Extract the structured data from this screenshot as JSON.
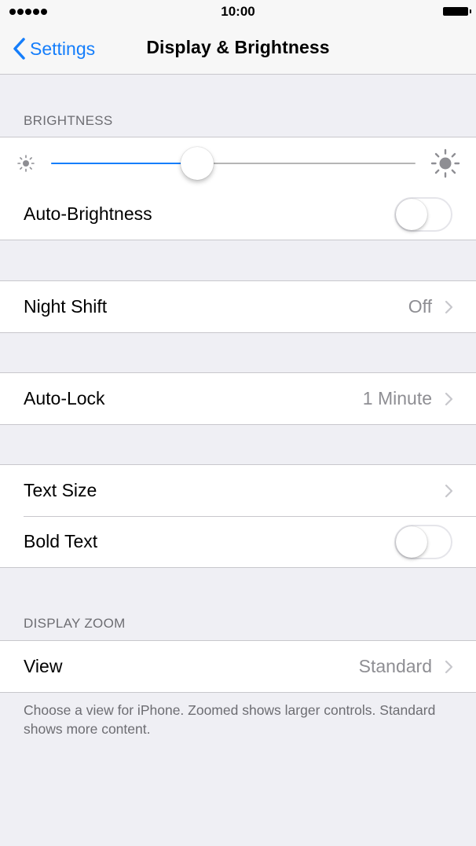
{
  "status_bar": {
    "time": "10:00",
    "signal_dots": 5
  },
  "nav": {
    "back_label": "Settings",
    "title": "Display & Brightness"
  },
  "brightness": {
    "header": "BRIGHTNESS",
    "level": 0.4,
    "auto_brightness_label": "Auto-Brightness",
    "auto_brightness_on": false
  },
  "night_shift": {
    "label": "Night Shift",
    "value": "Off"
  },
  "auto_lock": {
    "label": "Auto-Lock",
    "value": "1 Minute"
  },
  "text": {
    "text_size_label": "Text Size",
    "bold_text_label": "Bold Text",
    "bold_text_on": false
  },
  "display_zoom": {
    "header": "DISPLAY ZOOM",
    "view_label": "View",
    "view_value": "Standard",
    "footer": "Choose a view for iPhone. Zoomed shows larger controls. Standard shows more content."
  },
  "colors": {
    "accent": "#157efb",
    "background": "#efeff4",
    "secondary_text": "#8e8e93"
  },
  "icons": {
    "back": "chevron-left-icon",
    "disclosure": "chevron-right-icon",
    "brightness_low": "sun-small-icon",
    "brightness_high": "sun-large-icon",
    "battery": "battery-icon"
  }
}
